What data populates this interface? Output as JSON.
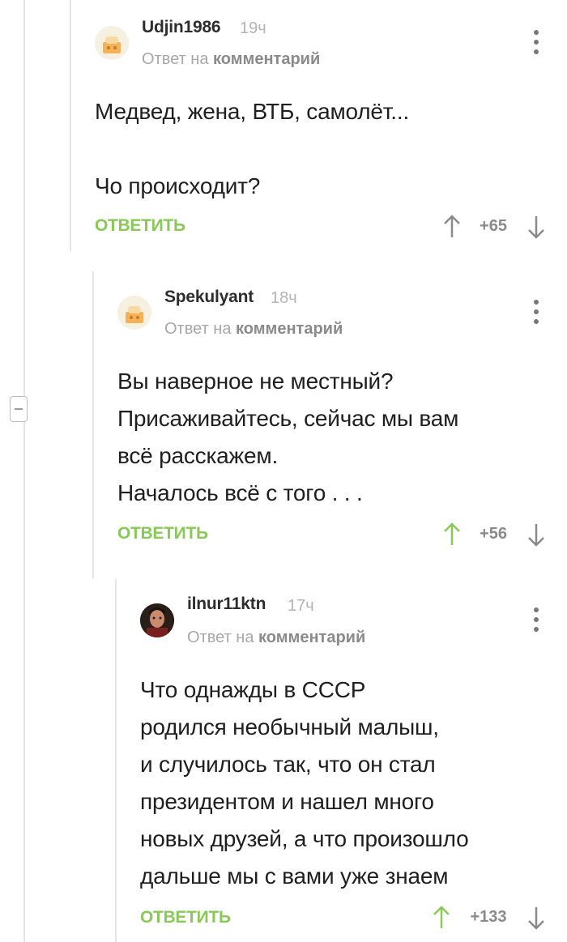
{
  "comments": [
    {
      "username": "Udjin1986",
      "time": "19ч",
      "reply_prefix": "Ответ на",
      "reply_target": "комментарий",
      "body": "Медвед, жена, ВТБ, самолёт...\n\nЧо происходит?",
      "reply_label": "ОТВЕТИТЬ",
      "score": "+65",
      "upvoted": false,
      "avatar": "default-avatar"
    },
    {
      "username": "Spekulyant",
      "time": "18ч",
      "reply_prefix": "Ответ на",
      "reply_target": "комментарий",
      "body": "Вы наверное не местный?\nПрисаживайтесь, сейчас мы вам\nвсё расскажем.\nНачалось всё с того . . .",
      "reply_label": "ОТВЕТИТЬ",
      "score": "+56",
      "upvoted": true,
      "avatar": "default-avatar"
    },
    {
      "username": "ilnur11ktn",
      "time": "17ч",
      "reply_prefix": "Ответ на",
      "reply_target": "комментарий",
      "body": "Что однажды в СССР\nродился необычный малыш,\nи случилось так, что он стал\nпрезидентом и нашел много\nновых друзей, а что произошло\nдальше мы с вами уже знаем",
      "reply_label": "ОТВЕТИТЬ",
      "score": "+133",
      "upvoted": true,
      "avatar": "user-photo-avatar"
    }
  ],
  "colors": {
    "accent_green": "#8ac858",
    "thread_line": "#e6e6e6",
    "vote_gray": "#8a8a8a"
  },
  "icons": {
    "collapse": "minus-box-icon",
    "menu": "kebab-menu-icon",
    "upvote": "arrow-up-icon",
    "downvote": "arrow-down-icon"
  }
}
